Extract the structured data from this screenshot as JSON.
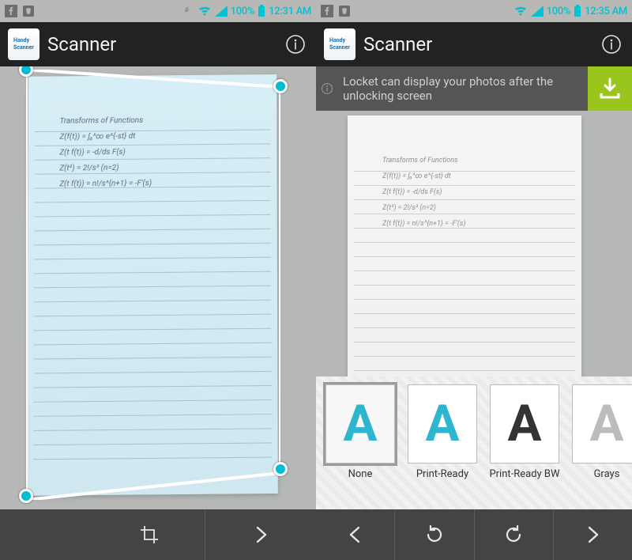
{
  "left": {
    "status": {
      "battery_pct": "100%",
      "time": "12:31 AM"
    },
    "app_title": "Scanner",
    "app_icon_label": "Handy\nScanner"
  },
  "right": {
    "status": {
      "battery_pct": "100%",
      "time": "12:35 AM"
    },
    "app_title": "Scanner",
    "app_icon_label": "Handy\nScanner",
    "banner_text": "Locket can display your photos after the unlocking screen",
    "filters": [
      {
        "label": "None",
        "glyph": "A",
        "color": "#2eb5d0",
        "selected": true
      },
      {
        "label": "Print-Ready",
        "glyph": "A",
        "color": "#2eb5d0",
        "selected": false
      },
      {
        "label": "Print-Ready BW",
        "glyph": "A",
        "color": "#333333",
        "selected": false
      },
      {
        "label": "Grays",
        "glyph": "A",
        "color": "#bcbcbc",
        "selected": false
      }
    ]
  },
  "colors": {
    "accent": "#2eb5d0",
    "download": "#9ac51d"
  }
}
